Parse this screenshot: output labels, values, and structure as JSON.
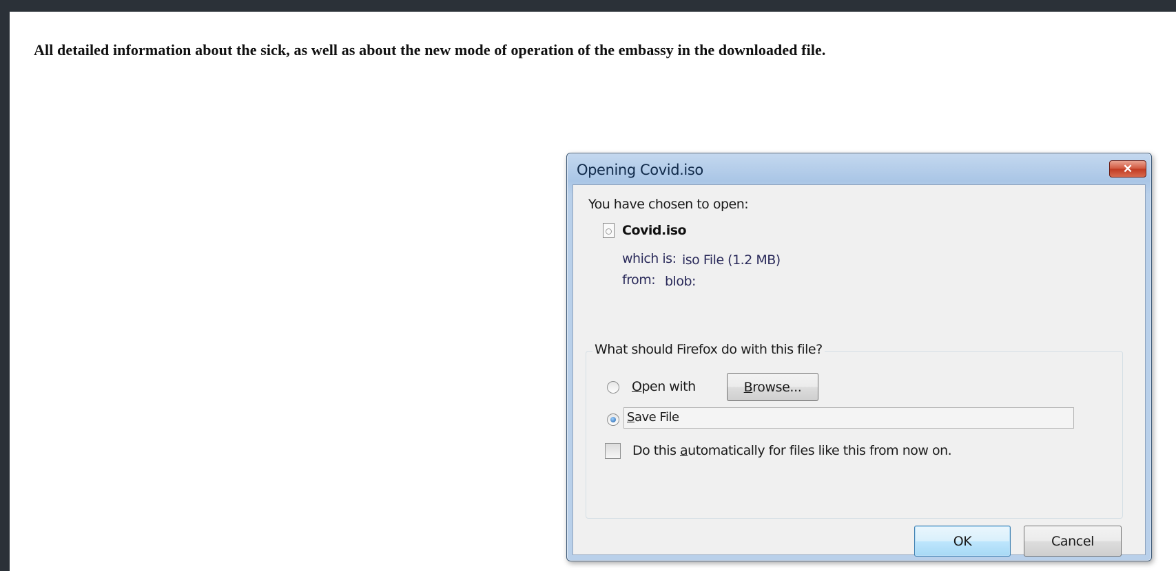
{
  "page": {
    "headline": "All detailed information about the sick, as well as about the new mode of operation of the embassy in the downloaded file."
  },
  "dialog": {
    "title": "Opening Covid.iso",
    "close_glyph": "✕",
    "intro": "You have chosen to open:",
    "file_name": "Covid.iso",
    "which_is_label": "which is:",
    "which_is_value": "iso File (1.2 MB)",
    "from_label": "from:",
    "from_value": "blob:",
    "action_group_label": "What should Firefox do with this file?",
    "open_with": {
      "mnemonic": "O",
      "label_rest": "pen with",
      "selected": false
    },
    "browse_button": {
      "mnemonic": "B",
      "label_rest": "rowse..."
    },
    "save_file": {
      "mnemonic": "S",
      "label_rest": "ave File",
      "selected": true
    },
    "auto_checkbox": {
      "label_before": "Do this ",
      "mnemonic": "a",
      "label_after": "utomatically for files like this from now on.",
      "checked": false
    },
    "ok_label": "OK",
    "cancel_label": "Cancel"
  },
  "colors": {
    "desktop": "#2b3138",
    "dialog_frame": "#aac6e6",
    "close_button": "#c13b22"
  }
}
